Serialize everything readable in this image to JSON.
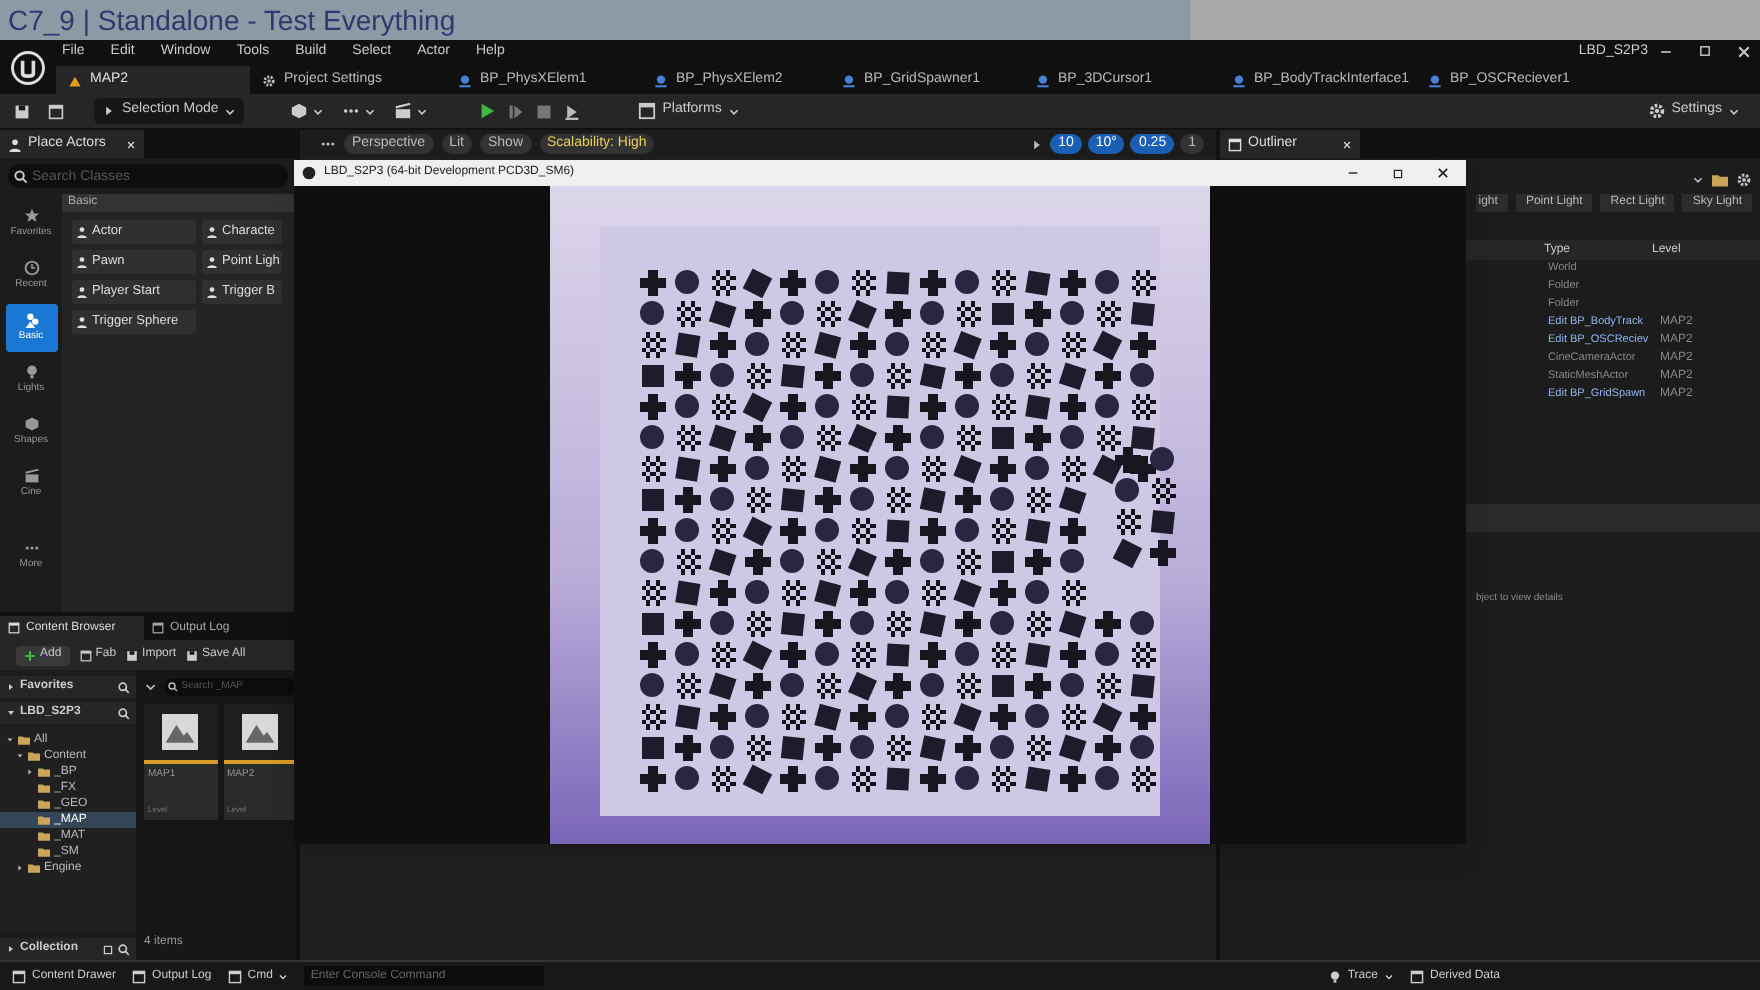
{
  "title_bar": {
    "title": "C7_9 | Standalone - Test Everything"
  },
  "menu": [
    "File",
    "Edit",
    "Window",
    "Tools",
    "Build",
    "Select",
    "Actor",
    "Help"
  ],
  "project_name": "LBD_S2P3",
  "document_tabs": [
    {
      "label": "MAP2",
      "kind": "level",
      "selected": true
    },
    {
      "label": "Project Settings",
      "kind": "settings",
      "selected": false
    },
    {
      "label": "BP_PhysXElem1",
      "kind": "blueprint",
      "selected": false
    },
    {
      "label": "BP_PhysXElem2",
      "kind": "blueprint",
      "selected": false
    },
    {
      "label": "BP_GridSpawner1",
      "kind": "blueprint",
      "selected": false
    },
    {
      "label": "BP_3DCursor1",
      "kind": "blueprint",
      "selected": false
    },
    {
      "label": "BP_BodyTrackInterface1",
      "kind": "blueprint",
      "selected": false
    },
    {
      "label": "BP_OSCReciever1",
      "kind": "blueprint",
      "selected": false
    }
  ],
  "toolbar": {
    "mode": "Selection Mode",
    "platforms": "Platforms",
    "settings": "Settings"
  },
  "place_actors": {
    "tab": "Place Actors",
    "search_placeholder": "Search Classes",
    "section": "Basic",
    "categories": [
      {
        "label": "Favorites",
        "selected": false
      },
      {
        "label": "Recent",
        "selected": false
      },
      {
        "label": "Basic",
        "selected": true
      },
      {
        "label": "Lights",
        "selected": false
      },
      {
        "label": "Shapes",
        "selected": false
      },
      {
        "label": "Cine",
        "selected": false
      },
      {
        "label": "More",
        "selected": false
      }
    ],
    "actors": [
      "Actor",
      "Characte",
      "Pawn",
      "Point Ligh",
      "Player Start",
      "Trigger B",
      "Trigger Sphere"
    ]
  },
  "viewport_toolbar": {
    "perspective": "Perspective",
    "lit": "Lit",
    "show": "Show",
    "scalability": "Scalability: High",
    "grid_snap": "10",
    "rotation_snap": "10°",
    "scale_snap": "0.25",
    "camera_speed": "1"
  },
  "game_window": {
    "title": "LBD_S2P3 (64-bit Development PCD3D_SM6)"
  },
  "content_browser": {
    "tabs": [
      {
        "label": "Content Browser",
        "selected": true
      },
      {
        "label": "Output Log",
        "selected": false
      }
    ],
    "buttons": [
      "Add",
      "Fab",
      "Import",
      "Save All"
    ],
    "favorites": "Favorites",
    "project": "LBD_S2P3",
    "search_placeholder": "Search _MAP",
    "tree": [
      {
        "label": "All",
        "expanded": true,
        "selected": false,
        "children": [
          {
            "label": "Content",
            "expanded": true,
            "selected": false,
            "children": [
              {
                "label": "_BP",
                "expanded": false,
                "selected": false
              },
              {
                "label": "_FX",
                "selected": false
              },
              {
                "label": "_GEO",
                "selected": false
              },
              {
                "label": "_MAP",
                "selected": true
              },
              {
                "label": "_MAT",
                "selected": false
              },
              {
                "label": "_SM",
                "selected": false
              }
            ]
          },
          {
            "label": "Engine",
            "expanded": false,
            "selected": false
          }
        ]
      }
    ],
    "assets": [
      {
        "name": "MAP1",
        "type": "Level"
      },
      {
        "name": "MAP2",
        "type": "Level"
      }
    ],
    "item_count": "4 items",
    "collection": "Collection"
  },
  "outliner": {
    "tab": "Outliner",
    "light_buttons": [
      "ight",
      "Point Light",
      "Rect Light",
      "Sky Light"
    ],
    "columns": [
      "Type",
      "Level"
    ],
    "rows": [
      {
        "kind": "plain",
        "type": "World"
      },
      {
        "kind": "plain",
        "type": "Folder"
      },
      {
        "kind": "plain",
        "type": "Folder"
      },
      {
        "kind": "link",
        "type": "Edit BP_BodyTrack",
        "level": "MAP2"
      },
      {
        "kind": "link",
        "type": "Edit BP_OSCReciev",
        "level": "MAP2"
      },
      {
        "kind": "plain",
        "type": "CineCameraActor",
        "level": "MAP2"
      },
      {
        "kind": "plain",
        "type": "StaticMeshActor",
        "level": "MAP2"
      },
      {
        "kind": "link",
        "type": "Edit BP_GridSpawn",
        "level": "MAP2"
      }
    ],
    "details_hint": "bject to view details"
  },
  "status_bar": {
    "content_drawer": "Content Drawer",
    "output_log": "Output Log",
    "cmd": "Cmd",
    "console_placeholder": "Enter Console Command",
    "trace": "Trace",
    "derived_data": "Derived Data"
  }
}
